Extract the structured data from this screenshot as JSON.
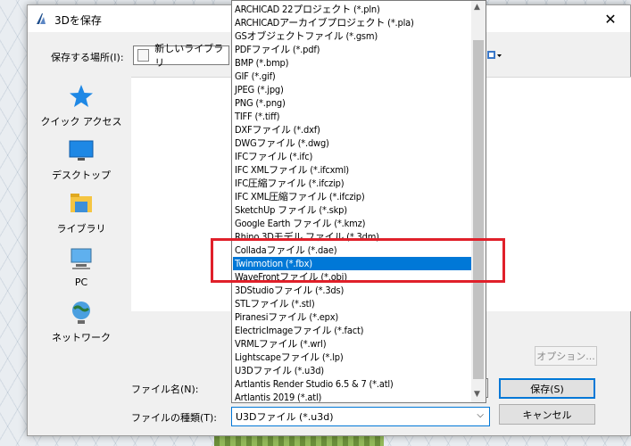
{
  "dialog": {
    "title": "3Dを保存",
    "close_glyph": "✕",
    "save_in_label": "保存する場所(I):",
    "location_value": "新しいライブラリ",
    "filename_label": "ファイル名(N):",
    "filename_value": "",
    "filetype_label": "ファイルの種類(T):",
    "filetype_value": "U3Dファイル (*.u3d)",
    "options_label": "オプション...",
    "save_label": "保存(S)",
    "cancel_label": "キャンセル"
  },
  "nav": [
    {
      "label": "クイック アクセス",
      "icon": "star-icon"
    },
    {
      "label": "デスクトップ",
      "icon": "desktop-icon"
    },
    {
      "label": "ライブラリ",
      "icon": "library-icon"
    },
    {
      "label": "PC",
      "icon": "pc-icon"
    },
    {
      "label": "ネットワーク",
      "icon": "network-icon"
    }
  ],
  "dropdown": {
    "selected_index": 18,
    "items": [
      "ARCHICAD 22プロジェクト (*.pln)",
      "ARCHICADアーカイブプロジェクト (*.pla)",
      "GSオブジェクトファイル (*.gsm)",
      "PDFファイル (*.pdf)",
      "BMP (*.bmp)",
      "GIF (*.gif)",
      "JPEG (*.jpg)",
      "PNG (*.png)",
      "TIFF (*.tiff)",
      "DXFファイル (*.dxf)",
      "DWGファイル (*.dwg)",
      "IFCファイル (*.ifc)",
      "IFC XMLファイル (*.ifcxml)",
      "IFC圧縮ファイル (*.ifczip)",
      "IFC XML圧縮ファイル (*.ifczip)",
      "SketchUp ファイル (*.skp)",
      "Google Earth ファイル (*.kmz)",
      "Rhino 3Dモデル ファイル (*.3dm)",
      "Colladaファイル (*.dae)",
      "Twinmotion (*.fbx)",
      "WaveFrontファイル (*.obj)",
      "3DStudioファイル (*.3ds)",
      "STLファイル (*.stl)",
      "Piranesiファイル (*.epx)",
      "ElectricImageファイル (*.fact)",
      "VRMLファイル (*.wrl)",
      "Lightscapeファイル (*.lp)",
      "U3Dファイル (*.u3d)",
      "Artlantis Render Studio 6.5 & 7 (*.atl)",
      "Artlantis 2019 (*.atl)"
    ]
  },
  "colors": {
    "selection": "#0078d7",
    "highlight": "#e0202a"
  }
}
